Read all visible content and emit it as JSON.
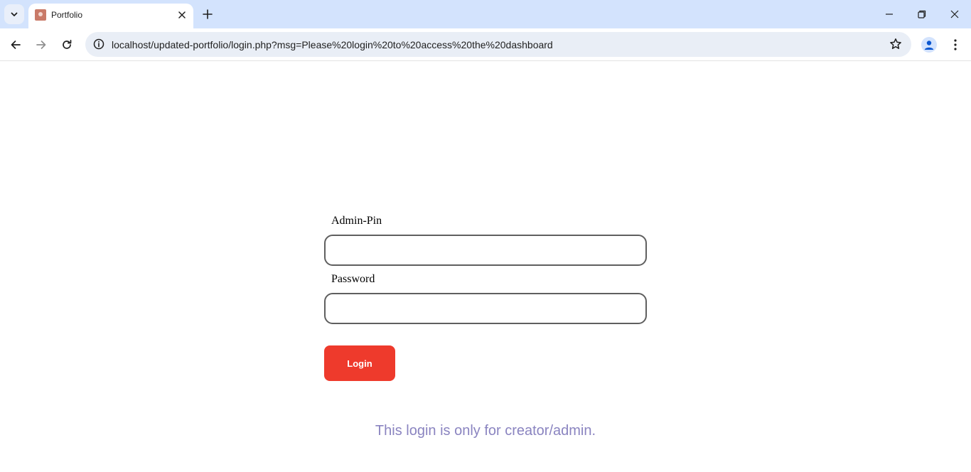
{
  "browser": {
    "tab": {
      "title": "Portfolio"
    },
    "address_bar": {
      "url": "localhost/updated-portfolio/login.php?msg=Please%20login%20to%20access%20the%20dashboard"
    },
    "icons": {
      "tab_search": "chevron-down-icon",
      "tab_close": "close-icon",
      "new_tab": "plus-icon",
      "back": "arrow-left-icon",
      "forward": "arrow-right-icon",
      "reload": "reload-icon",
      "site_info": "info-icon",
      "bookmark": "star-outline-icon",
      "profile": "person-icon",
      "menu": "kebab-menu-icon",
      "minimize": "minimize-icon",
      "restore": "restore-icon",
      "close_window": "close-icon"
    }
  },
  "login": {
    "admin_pin_label": "Admin-Pin",
    "admin_pin_value": "",
    "password_label": "Password",
    "password_value": "",
    "submit_label": "Login",
    "notice": "This login is only for creator/admin."
  },
  "colors": {
    "tabstrip_bg": "#d3e3fd",
    "omnibox_bg": "#e9eef6",
    "button_bg": "#ee3a2c",
    "button_text": "#ffffff",
    "notice_text": "#8a84c0",
    "input_border": "#5f5f5f"
  }
}
